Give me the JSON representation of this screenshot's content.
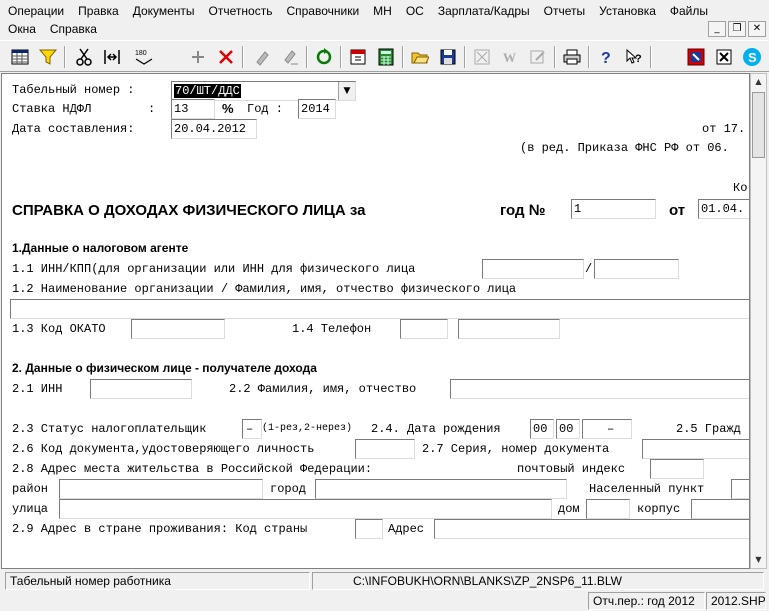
{
  "menu": {
    "row1": [
      "Операции",
      "Правка",
      "Документы",
      "Отчетность",
      "Справочники",
      "МН",
      "ОС",
      "Зарплата/Кадры",
      "Отчеты",
      "Установка",
      "Файлы"
    ],
    "row2": [
      "Окна",
      "Справка"
    ]
  },
  "window_controls": {
    "minimize": "_",
    "restore": "❐",
    "close": "✕"
  },
  "toolbar": {
    "icons": [
      "grid-icon",
      "filter-icon",
      "cut-icon",
      "split-icon",
      "sort-icon",
      "add-icon",
      "delete-icon",
      "paint-icon",
      "paint-text-icon",
      "refresh-icon",
      "calendar-icon",
      "calculator-icon",
      "open-folder-icon",
      "save-icon",
      "grid-disabled-icon",
      "w-disabled-icon",
      "edit-disabled-icon",
      "print-icon",
      "help-icon",
      "context-help-icon",
      "export-icon",
      "close-doc-icon",
      "skype-icon"
    ],
    "sort_text": "180"
  },
  "form": {
    "tab_number_label": "Табельный номер :",
    "tab_number_value": "70/ШТ/ДДС",
    "ndfl_rate_label": "Ставка НДФЛ",
    "colon": ":",
    "ndfl_rate_value": "13",
    "percent": "%",
    "year_label": "Год :",
    "year_value": "2014",
    "date_label": "Дата составления:",
    "date_value": "20.04.2012",
    "note_from": "от 17.",
    "note_edit": "(в ред. Приказа ФНС РФ от 06.",
    "note_ko": "Ко",
    "title": "СПРАВКА О ДОХОДАХ ФИЗИЧЕСКОГО ЛИЦА за",
    "title_year": "год №",
    "title_num": "1",
    "title_from": "от",
    "title_date": "01.04.",
    "section1": "1.Данные о налоговом агенте",
    "s1_1": "1.1 ИНН/КПП(для организации или ИНН для физического лица",
    "slash": "/",
    "s1_2": "1.2 Наименование организации / Фамилия, имя, отчество физического лица",
    "s1_3": "1.3 Код ОКАТО",
    "s1_4": "1.4 Телефон",
    "section2": "2. Данные о физическом лице - получателе дохода",
    "s2_1": "2.1 ИНН",
    "s2_2": "2.2 Фамилия, имя, отчество",
    "s2_3": "2.3 Статус налогоплательщик",
    "s2_3_value": "–",
    "s2_3_hint": "(1-рез,2-нерез)",
    "s2_4": "2.4. Дата рождения",
    "birth_day": "00",
    "birth_month": "00",
    "birth_year": "–",
    "s2_5": "2.5 Гражд",
    "s2_6": "2.6 Код документа,удостоверяющего личность",
    "s2_7": "2.7 Серия, номер документа",
    "s2_8": "2.8 Адрес места жительства в Российской Федерации:",
    "postal": "почтовый индекс",
    "district": "район",
    "city": "город",
    "locality": "Населенный пункт",
    "street": "улица",
    "house": "дом",
    "building": "корпус",
    "s2_9": "2.9 Адрес в стране проживания: Код страны",
    "address": "Адрес"
  },
  "status": {
    "hint": "Табельный номер работника",
    "path": "C:\\INFOBUKH\\ORN\\BLANKS\\ZP_2NSP6_11.BLW",
    "period": "Отч.пер.: год 2012",
    "file": "2012.SHP"
  }
}
